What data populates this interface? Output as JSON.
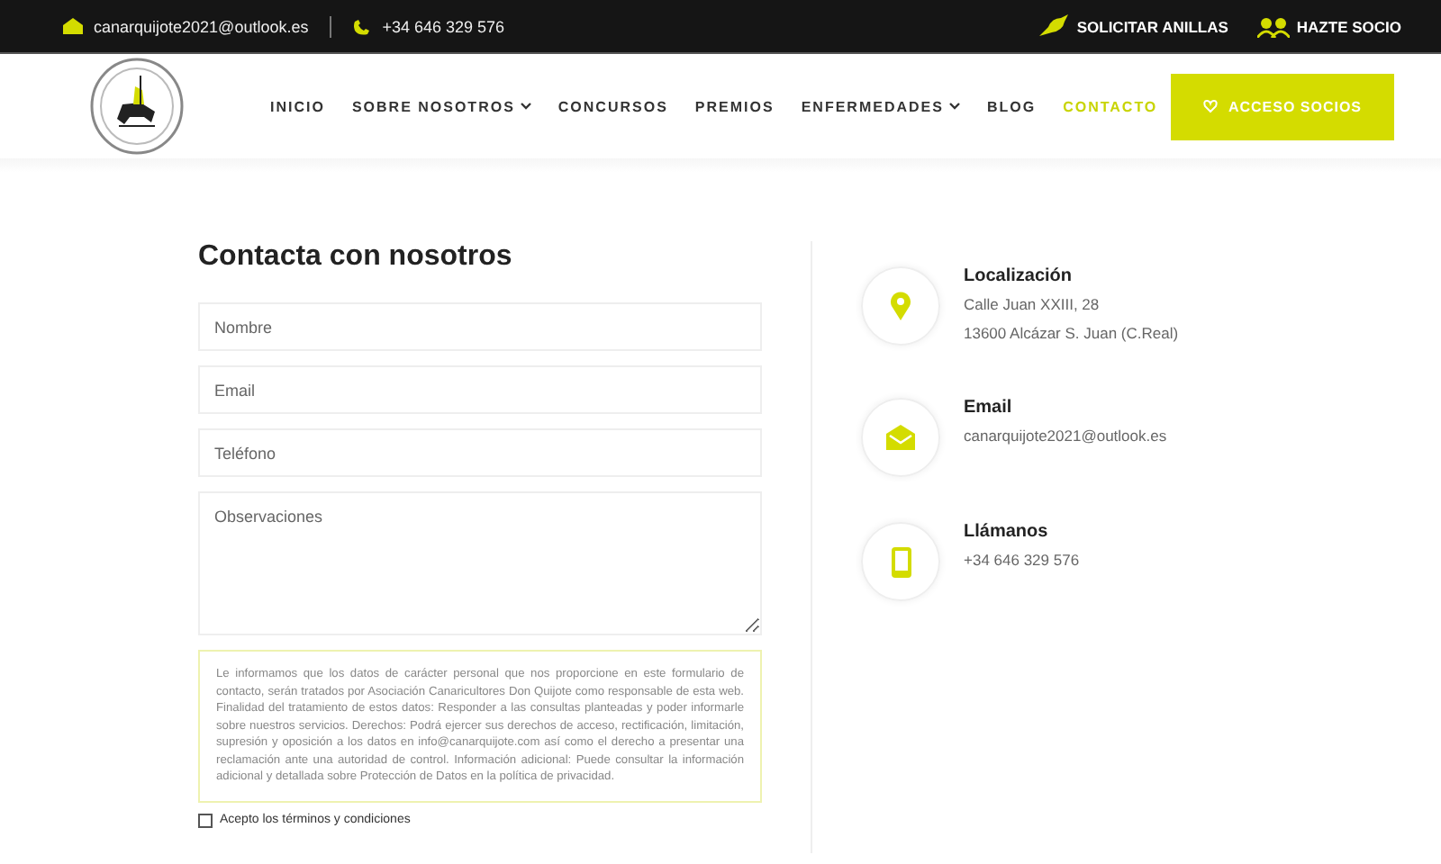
{
  "top_bar": {
    "email": "canarquijote2021@outlook.es",
    "phone": "+34 646 329 576",
    "links": [
      {
        "kind": "bird",
        "label": "SOLICITAR ANILLAS"
      },
      {
        "kind": "people",
        "label": "HAZTE SOCIO"
      }
    ]
  },
  "nav": {
    "items": [
      {
        "label": "INICIO",
        "dropdown": false,
        "selected": false
      },
      {
        "label": "SOBRE NOSOTROS",
        "dropdown": true,
        "selected": false
      },
      {
        "label": "CONCURSOS",
        "dropdown": false,
        "selected": false
      },
      {
        "label": "PREMIOS",
        "dropdown": false,
        "selected": false
      },
      {
        "label": "ENFERMEDADES",
        "dropdown": true,
        "selected": false
      },
      {
        "label": "BLOG",
        "dropdown": false,
        "selected": false
      },
      {
        "label": "CONTACTO",
        "dropdown": false,
        "selected": true
      }
    ],
    "button": "ACCESO SOCIOS"
  },
  "form": {
    "title": "Contacta con nosotros",
    "fields": [
      {
        "placeholder": "Nombre",
        "kind": "input"
      },
      {
        "placeholder": "Email",
        "kind": "input"
      },
      {
        "placeholder": "Teléfono",
        "kind": "input"
      },
      {
        "placeholder": "Observaciones",
        "kind": "textarea"
      }
    ],
    "notice": "Le informamos que los datos de carácter personal que nos proporcione en este formulario de contacto, serán tratados por Asociación Canaricultores Don Quijote como responsable de esta web. Finalidad del tratamiento de estos datos: Responder a las consultas planteadas y poder informarle sobre nuestros servicios. Derechos: Podrá ejercer sus derechos de acceso, rectificación, limitación, supresión y oposición a los datos en info@canarquijote.com así como el derecho a presentar una reclamación ante una autoridad de control. Información adicional: Puede consultar la información adicional y detallada sobre Protección de Datos en la política de privacidad.",
    "terms": {
      "label": "Acepto los términos y condiciones",
      "checked": false
    }
  },
  "contact": [
    {
      "kind": "location",
      "title": "Localización",
      "lines": [
        "Calle Juan XXIII, 28",
        "13600 Alcázar S. Juan (C.Real)"
      ]
    },
    {
      "kind": "email",
      "title": "Email",
      "lines": [
        "canarquijote2021@outlook.es"
      ]
    },
    {
      "kind": "phone",
      "title": "Llámanos",
      "lines": [
        "+34 646 329 576"
      ]
    }
  ]
}
